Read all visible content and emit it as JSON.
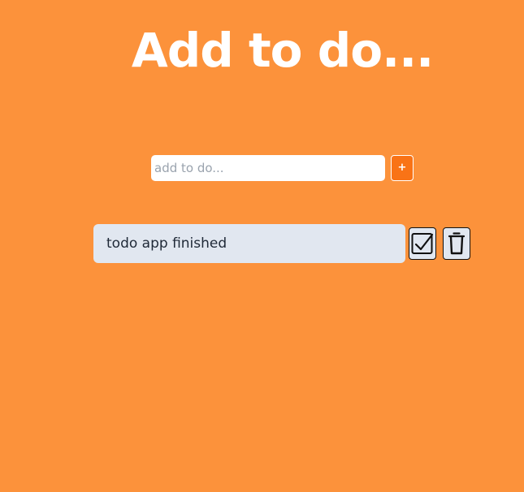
{
  "header": {
    "title": "Add to do..."
  },
  "add_form": {
    "input_placeholder": "add to do...",
    "input_value": "",
    "add_button_label": "+"
  },
  "todos": [
    {
      "text": "todo app finished",
      "complete_icon": "checkbox-check-icon",
      "delete_icon": "trash-icon"
    }
  ],
  "colors": {
    "background": "#fc923b",
    "accent_button": "#f97316",
    "todo_item_background": "#e1e7f0",
    "title_text": "#ffffff"
  }
}
